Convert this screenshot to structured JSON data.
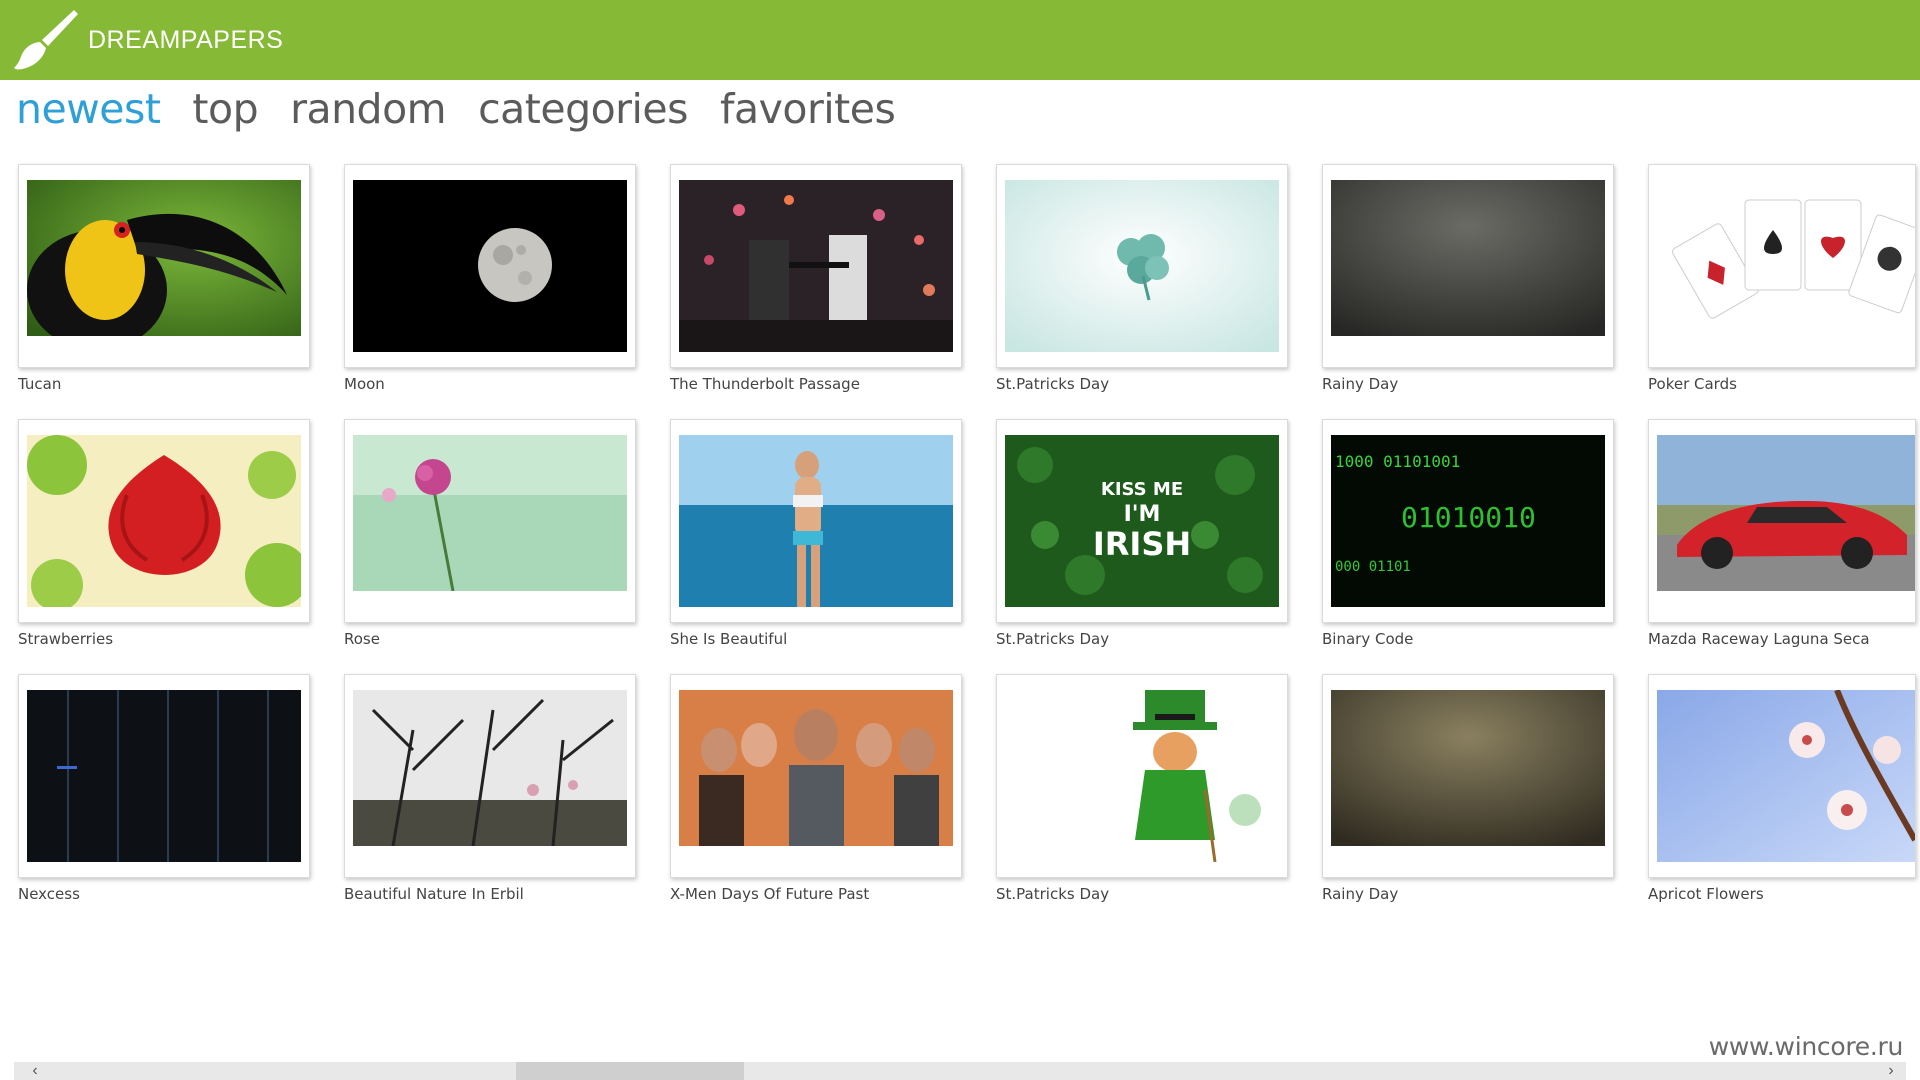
{
  "app": {
    "title": "DREAMPAPERS",
    "logo_icon": "paintbrush-icon",
    "accent": "#86b935"
  },
  "nav": {
    "items": [
      {
        "label": "newest",
        "active": true
      },
      {
        "label": "top",
        "active": false
      },
      {
        "label": "random",
        "active": false
      },
      {
        "label": "categories",
        "active": false
      },
      {
        "label": "favorites",
        "active": false
      }
    ],
    "active_color": "#2f9fd8"
  },
  "wallpapers": [
    {
      "title": "Tucan"
    },
    {
      "title": "Moon"
    },
    {
      "title": "The Thunderbolt Passage"
    },
    {
      "title": "St.Patricks Day"
    },
    {
      "title": "Rainy Day"
    },
    {
      "title": "Poker Cards"
    },
    {
      "title": "Strawberries"
    },
    {
      "title": "Rose"
    },
    {
      "title": "She Is Beautiful"
    },
    {
      "title": "St.Patricks Day"
    },
    {
      "title": "Binary Code"
    },
    {
      "title": "Mazda Raceway Laguna Seca"
    },
    {
      "title": "Nexcess"
    },
    {
      "title": "Beautiful Nature In Erbil"
    },
    {
      "title": "X-Men Days Of Future Past"
    },
    {
      "title": "St.Patricks Day"
    },
    {
      "title": "Rainy Day"
    },
    {
      "title": "Apricot Flowers"
    }
  ],
  "thumb_texts": {
    "kiss_me": "KISS ME",
    "im": "I'M",
    "irish": "IRISH",
    "binary_1": "1000 01101001",
    "binary_2": "01010010",
    "binary_3": "000 01101"
  },
  "watermark": "www.wincore.ru",
  "scrollbar": {
    "left_icon": "chevron-left-icon",
    "right_icon": "chevron-right-icon"
  }
}
